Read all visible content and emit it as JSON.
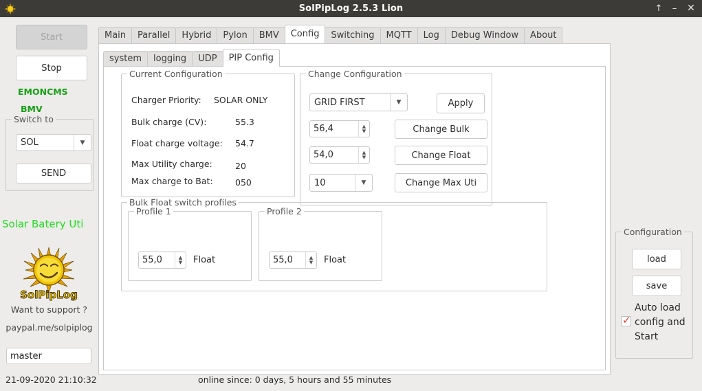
{
  "window": {
    "title": "SolPipLog 2.5.3 Lion",
    "icon": "sun-icon",
    "buttons": {
      "maximize": "↑",
      "minimize": "–",
      "close": "✕"
    }
  },
  "sidebar": {
    "start_label": "Start",
    "stop_label": "Stop",
    "status_labels": [
      "EMONCMS",
      "BMV"
    ],
    "switch_to": {
      "title": "Switch to",
      "selected": "SOL",
      "send_label": "SEND"
    },
    "solar_status": "Solar Batery Uti",
    "logo_text": "SolPipLog",
    "support_text": "Want to support ?",
    "paypal_text": "paypal.me/solpiplog",
    "master_field": "master"
  },
  "tabs": {
    "main": [
      {
        "label": "Main",
        "active": false
      },
      {
        "label": "Parallel",
        "active": false
      },
      {
        "label": "Hybrid",
        "active": false
      },
      {
        "label": "Pylon",
        "active": false
      },
      {
        "label": "BMV",
        "active": false
      },
      {
        "label": "Config",
        "active": true
      },
      {
        "label": "Switching",
        "active": false
      },
      {
        "label": "MQTT",
        "active": false
      },
      {
        "label": "Log",
        "active": false
      },
      {
        "label": "Debug Window",
        "active": false
      },
      {
        "label": "About",
        "active": false
      }
    ],
    "sub": [
      {
        "label": "system",
        "active": false
      },
      {
        "label": "logging",
        "active": false
      },
      {
        "label": "UDP",
        "active": false
      },
      {
        "label": "PIP Config",
        "active": true
      }
    ]
  },
  "current_configuration": {
    "title": "Current Configuration",
    "rows": [
      {
        "label": "Charger Priority:",
        "value": "SOLAR ONLY"
      },
      {
        "label": "Bulk charge (CV):",
        "value": "55.3"
      },
      {
        "label": "Float charge voltage:",
        "value": "54.7"
      },
      {
        "label": "Max Utility charge:",
        "value": "20"
      },
      {
        "label": "Max charge to Bat:",
        "value": "050"
      }
    ]
  },
  "change_configuration": {
    "title": "Change Configuration",
    "priority_selected": "GRID FIRST",
    "apply_label": "Apply",
    "bulk_value": "56,4",
    "bulk_button": "Change Bulk",
    "float_value": "54,0",
    "float_button": "Change Float",
    "maxuti_value": "10",
    "maxuti_button": "Change Max Uti"
  },
  "profiles": {
    "title": "Bulk Float switch profiles",
    "items": [
      {
        "title": "Profile 1",
        "value": "55,0",
        "label": "Float"
      },
      {
        "title": "Profile 2",
        "value": "55,0",
        "label": "Float"
      }
    ]
  },
  "right_configuration": {
    "title": "Configuration",
    "load_label": "load",
    "save_label": "save",
    "autoload_label": "Auto load config and Start",
    "autoload_checked": true
  },
  "statusbar": {
    "datetime": "21-09-2020 21:10:32",
    "online": "online since: 0 days, 5 hours  and 55 minutes"
  },
  "colors": {
    "titlebar": "#3c3b37",
    "background": "#edecea",
    "panel": "#ffffff",
    "green_status": "#15a015",
    "bright_green": "#22dd22",
    "check_red": "#e03a2f"
  }
}
